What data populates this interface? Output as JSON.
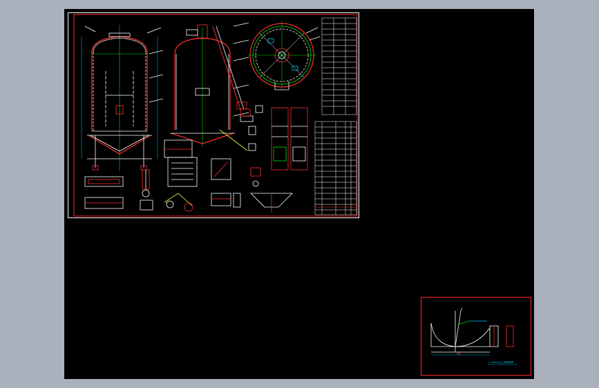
{
  "canvas": {
    "background": "#000000",
    "workspace_background": "#aab1bd"
  },
  "colors": {
    "frame": "#ff2a2a",
    "linework": "#ffffff",
    "axis": "#00e000",
    "accent": "#ff3030",
    "annotation": "#00c8ff",
    "leader": "#ffff40"
  },
  "detail_sheet": {
    "note": "Ⅰ-Ⅰ 20mm以上不得有焊"
  }
}
